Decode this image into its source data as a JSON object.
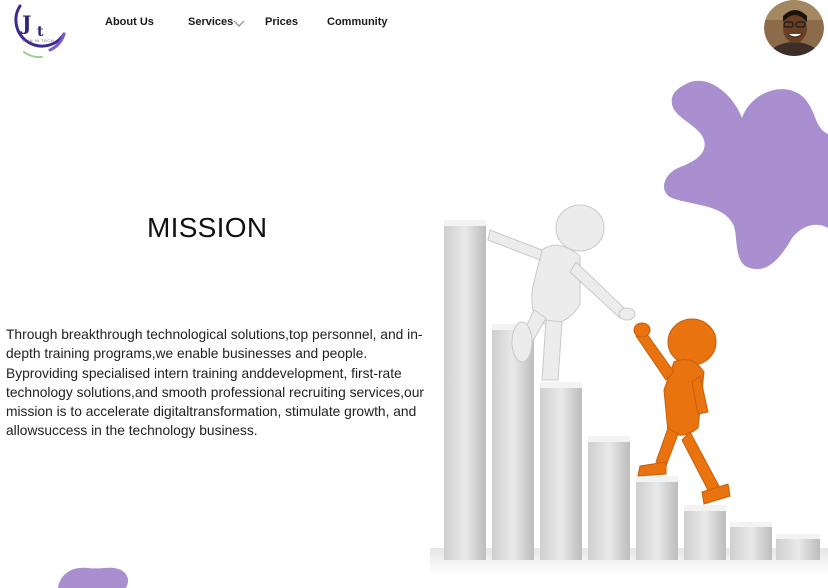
{
  "header": {
    "logo_initials": "J T",
    "logo_tagline": "JOIN IN TECH",
    "nav": {
      "about_label": "About Us",
      "services_label": "Services",
      "prices_label": "Prices",
      "community_label": "Community"
    }
  },
  "icons": {
    "services_dropdown": "chevron-down-icon",
    "avatar": "user-avatar"
  },
  "main": {
    "heading": "MISSION",
    "body": "Through breakthrough technological solutions,top personnel, and in-depth training programs,we enable businesses and people. Byproviding specialised intern training anddevelopment, first-rate technology solutions,and smooth professional recruiting services,our mission is to accelerate digitaltransformation, stimulate growth, and allowsuccess in the technology business."
  },
  "colors": {
    "accent": "#a98fcf",
    "logo_ring": "#5b3a9c",
    "figure_orange": "#e8730f",
    "figure_white": "#eeeeee"
  }
}
